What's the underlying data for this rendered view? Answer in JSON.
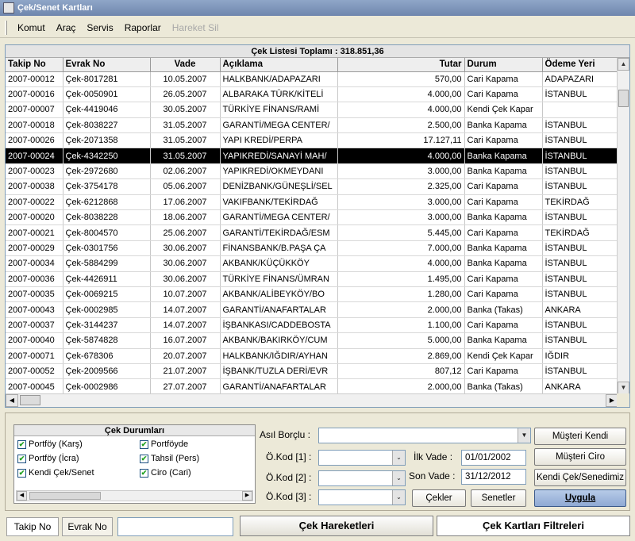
{
  "window": {
    "title": "Çek/Senet Kartları"
  },
  "menu": [
    "Komut",
    "Araç",
    "Servis",
    "Raporlar",
    "Hareket Sil"
  ],
  "grid": {
    "title": "Çek Listesi Toplamı : 318.851,36",
    "columns": [
      "Takip No",
      "Evrak No",
      "Vade",
      "Açıklama",
      "Tutar",
      "Durum",
      "Ödeme Yeri"
    ],
    "selected_row": 5,
    "rows": [
      [
        "2007-00012",
        "Çek-8017281",
        "10.05.2007",
        "HALKBANK/ADAPAZARI",
        "570,00",
        "Cari Kapama",
        "ADAPAZARI"
      ],
      [
        "2007-00016",
        "Çek-0050901",
        "26.05.2007",
        "ALBARAKA TÜRK/KİTELİ",
        "4.000,00",
        "Cari Kapama",
        "İSTANBUL"
      ],
      [
        "2007-00007",
        "Çek-4419046",
        "30.05.2007",
        "TÜRKİYE FİNANS/RAMİ",
        "4.000,00",
        "Kendi Çek Kapar",
        ""
      ],
      [
        "2007-00018",
        "Çek-8038227",
        "31.05.2007",
        "GARANTİ/MEGA CENTER/",
        "2.500,00",
        "Banka Kapama",
        "İSTANBUL"
      ],
      [
        "2007-00026",
        "Çek-2071358",
        "31.05.2007",
        "YAPI KREDİ/PERPA",
        "17.127,11",
        "Cari Kapama",
        "İSTANBUL"
      ],
      [
        "2007-00024",
        "Çek-4342250",
        "31.05.2007",
        "YAPIKREDİ/SANAYİ MAH/",
        "4.000,00",
        "Banka Kapama",
        "İSTANBUL"
      ],
      [
        "2007-00023",
        "Çek-2972680",
        "02.06.2007",
        "YAPIKREDİ/OKMEYDANI",
        "3.000,00",
        "Banka Kapama",
        "İSTANBUL"
      ],
      [
        "2007-00038",
        "Çek-3754178",
        "05.06.2007",
        "DENİZBANK/GÜNEŞLİ/SEL",
        "2.325,00",
        "Cari Kapama",
        "İSTANBUL"
      ],
      [
        "2007-00022",
        "Çek-6212868",
        "17.06.2007",
        "VAKIFBANK/TEKİRDAĞ",
        "3.000,00",
        "Cari Kapama",
        "TEKİRDAĞ"
      ],
      [
        "2007-00020",
        "Çek-8038228",
        "18.06.2007",
        "GARANTİ/MEGA CENTER/",
        "3.000,00",
        "Banka Kapama",
        "İSTANBUL"
      ],
      [
        "2007-00021",
        "Çek-8004570",
        "25.06.2007",
        "GARANTİ/TEKİRDAĞ/ESM",
        "5.445,00",
        "Cari Kapama",
        "TEKİRDAĞ"
      ],
      [
        "2007-00029",
        "Çek-0301756",
        "30.06.2007",
        "FİNANSBANK/B.PAŞA ÇA",
        "7.000,00",
        "Banka Kapama",
        "İSTANBUL"
      ],
      [
        "2007-00034",
        "Çek-5884299",
        "30.06.2007",
        "AKBANK/KÜÇÜKKÖY",
        "4.000,00",
        "Banka Kapama",
        "İSTANBUL"
      ],
      [
        "2007-00036",
        "Çek-4426911",
        "30.06.2007",
        "TÜRKİYE FİNANS/ÜMRAN",
        "1.495,00",
        "Cari Kapama",
        "İSTANBUL"
      ],
      [
        "2007-00035",
        "Çek-0069215",
        "10.07.2007",
        "AKBANK/ALİBEYKÖY/BO",
        "1.280,00",
        "Cari Kapama",
        "İSTANBUL"
      ],
      [
        "2007-00043",
        "Çek-0002985",
        "14.07.2007",
        "GARANTİ/ANAFARTALAR",
        "2.000,00",
        "Banka (Takas)",
        "ANKARA"
      ],
      [
        "2007-00037",
        "Çek-3144237",
        "14.07.2007",
        "İŞBANKASI/CADDEBOSTA",
        "1.100,00",
        "Cari Kapama",
        "İSTANBUL"
      ],
      [
        "2007-00040",
        "Çek-5874828",
        "16.07.2007",
        "AKBANK/BAKIRKÖY/CUM",
        "5.000,00",
        "Banka Kapama",
        "İSTANBUL"
      ],
      [
        "2007-00071",
        "Çek-678306",
        "20.07.2007",
        "HALKBANK/IĞDIR/AYHAN",
        "2.869,00",
        "Kendi Çek Kapar",
        "IĞDIR"
      ],
      [
        "2007-00052",
        "Çek-2009566",
        "21.07.2007",
        "İŞBANK/TUZLA DERİ/EVR",
        "807,12",
        "Cari Kapama",
        "İSTANBUL"
      ],
      [
        "2007-00045",
        "Çek-0002986",
        "27.07.2007",
        "GARANTİ/ANAFARTALAR",
        "2.000,00",
        "Banka (Takas)",
        "ANKARA"
      ]
    ]
  },
  "filters": {
    "status_title": "Çek Durumları",
    "statuses": [
      {
        "label": "Portföy (Karş)",
        "checked": true
      },
      {
        "label": "Portföyde",
        "checked": true
      },
      {
        "label": "Portföy (İcra)",
        "checked": true
      },
      {
        "label": "Tahsil (Pers)",
        "checked": true
      },
      {
        "label": "Kendi Çek/Senet",
        "checked": true
      },
      {
        "label": "Ciro (Cari)",
        "checked": true
      }
    ],
    "asil_borclu_label": "Asıl Borçlu :",
    "okod1_label": "Ö.Kod [1] :",
    "okod2_label": "Ö.Kod [2] :",
    "okod3_label": "Ö.Kod [3] :",
    "ilk_vade_label": "İlk Vade :",
    "ilk_vade_value": "01/01/2002",
    "son_vade_label": "Son Vade :",
    "son_vade_value": "31/12/2012",
    "buttons": {
      "musteri_kendi": "Müşteri Kendi",
      "musteri_ciro": "Müşteri Ciro",
      "kendi_cek": "Kendi Çek/Senedimiz",
      "cekler": "Çekler",
      "senetler": "Senetler",
      "uygula": "Uygula"
    }
  },
  "bottom": {
    "tab_takip": "Takip No",
    "tab_evrak": "Evrak No",
    "search_value": "",
    "cek_hareketleri": "Çek Hareketleri",
    "cek_kartlari_filtreleri": "Çek Kartları Filtreleri"
  }
}
